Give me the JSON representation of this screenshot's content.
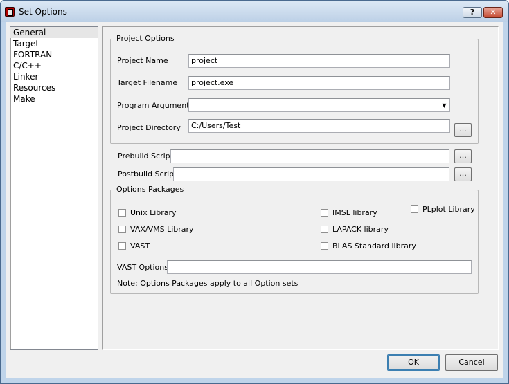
{
  "window": {
    "title": "Set Options",
    "help_label": "?",
    "close_label": "✕"
  },
  "nav": {
    "items": [
      "General",
      "Target",
      "FORTRAN",
      "C/C++",
      "Linker",
      "Resources",
      "Make"
    ],
    "selected": "General"
  },
  "project_options": {
    "group_title": "Project Options",
    "project_name_label": "Project Name",
    "project_name_value": "project",
    "target_filename_label": "Target Filename",
    "target_filename_value": "project.exe",
    "program_arguments_label": "Program Arguments",
    "program_arguments_value": "",
    "project_directory_label": "Project Directory",
    "project_directory_value": "C:/Users/Test",
    "browse_label": "..."
  },
  "scripts": {
    "prebuild_label": "Prebuild Script",
    "prebuild_value": "",
    "postbuild_label": "Postbuild Script",
    "postbuild_value": "",
    "browse_label": "..."
  },
  "options_packages": {
    "group_title": "Options Packages",
    "unix_library": "Unix Library",
    "vax_vms_library": "VAX/VMS Library",
    "vast": "VAST",
    "imsl_library": "IMSL library",
    "lapack_library": "LAPACK library",
    "blas_library": "BLAS Standard library",
    "plplot_library": "PLplot Library",
    "vast_options_label": "VAST Options",
    "vast_options_value": "",
    "note": "Note: Options Packages apply to all Option sets"
  },
  "buttons": {
    "ok": "OK",
    "cancel": "Cancel"
  }
}
